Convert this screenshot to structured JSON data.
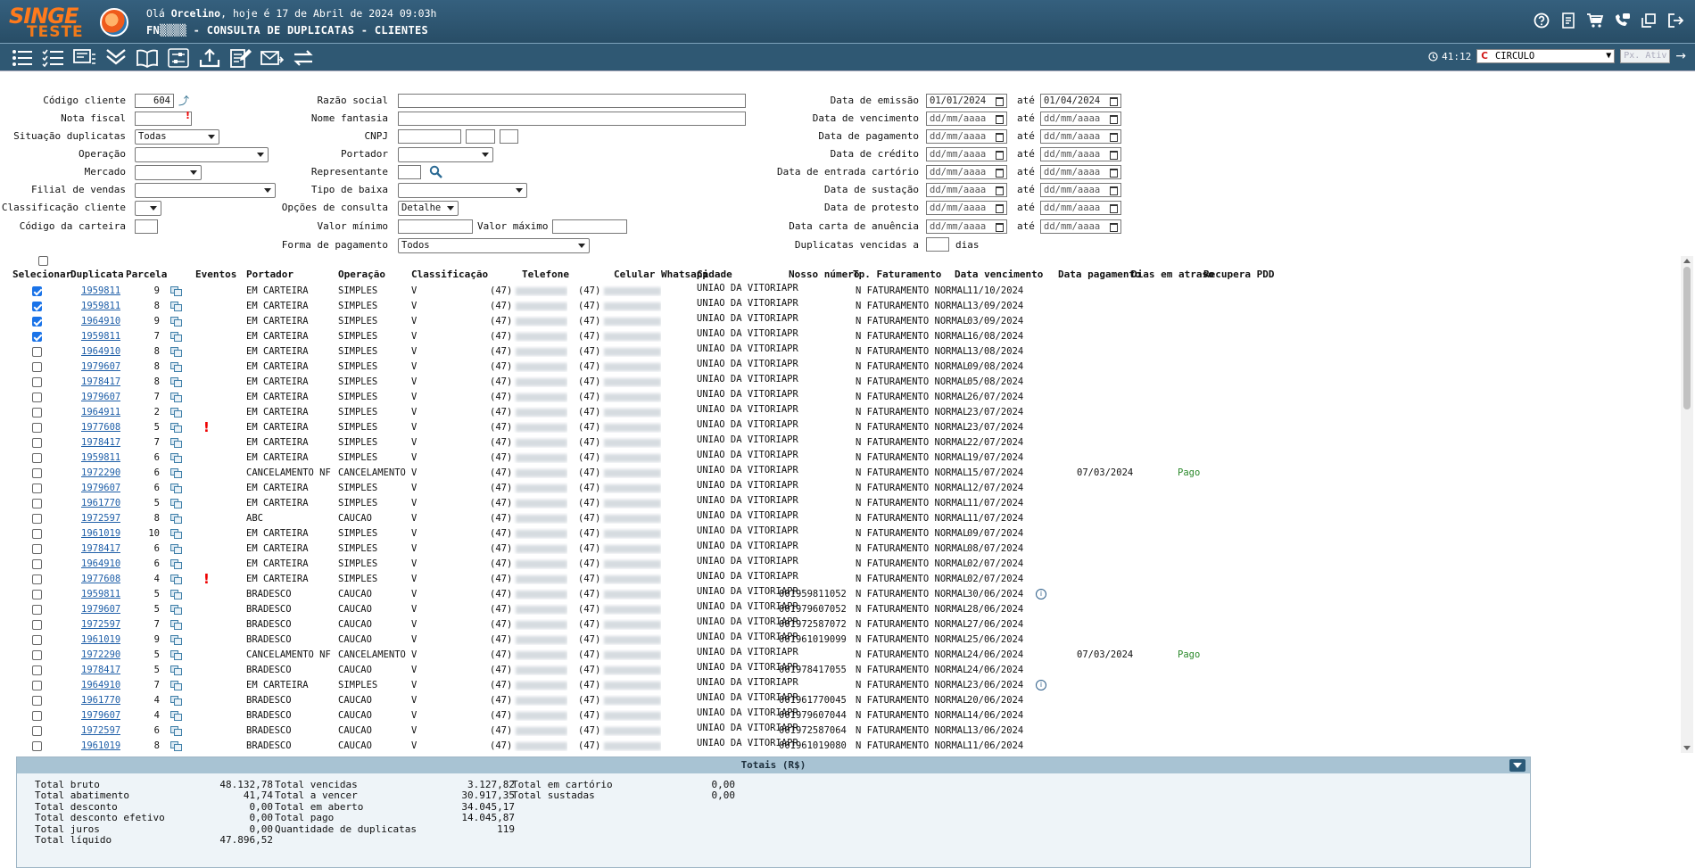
{
  "header": {
    "logo_text": "SINGE",
    "logo_subtext": "TESTE",
    "greeting_prefix": "Olá ",
    "user_name": "Orcelino",
    "greeting_suffix": ", hoje é 17 de Abril de 2024 09:03h",
    "page_title": "FN▒▒▒▒ - CONSULTA DE DUPLICATAS - CLIENTES",
    "icons": [
      "help-icon",
      "report-icon",
      "cart-icon",
      "phone-chat-icon",
      "window-icon",
      "exit-icon"
    ]
  },
  "toolbar": {
    "icons": [
      "list-icon",
      "list-check-icon",
      "card-list-icon",
      "expand-all-icon",
      "book-icon",
      "sliders-icon",
      "upload-icon",
      "edit-doc-icon",
      "send-mail-icon",
      "swap-icon"
    ],
    "timer": "41:12",
    "company": "CIRCULO",
    "company_badge": "C",
    "px_ativ_placeholder": "Px. Ativ"
  },
  "filters": {
    "codigo_cliente_label": "Código cliente",
    "codigo_cliente_value": "604",
    "nota_fiscal_label": "Nota fiscal",
    "situacao_label": "Situação duplicatas",
    "situacao_value": "Todas",
    "operacao_label": "Operação",
    "mercado_label": "Mercado",
    "filial_label": "Filial de vendas",
    "classificacao_label": "Classificação cliente",
    "codigo_carteira_label": "Código da carteira",
    "razao_label": "Razão social",
    "fantasia_label": "Nome fantasia",
    "cnpj_label": "CNPJ",
    "portador_label": "Portador",
    "representante_label": "Representante",
    "tipo_baixa_label": "Tipo de baixa",
    "opcoes_label": "Opções de consulta",
    "opcoes_value": "Detalhe",
    "valor_minimo_label": "Valor mínimo",
    "valor_maximo_label": "Valor máximo",
    "forma_pagamento_label": "Forma de pagamento",
    "forma_pagamento_value": "Todos",
    "ate": "até",
    "date_placeholder": "dd/mm/aaaa",
    "emissao_label": "Data de emissão",
    "emissao_from": "01/01/2024",
    "emissao_to": "01/04/2024",
    "vencimento_label": "Data de vencimento",
    "pagamento_label": "Data de pagamento",
    "credito_label": "Data de crédito",
    "cartorio_label": "Data de entrada cartório",
    "sustacao_label": "Data de sustação",
    "protesto_label": "Data de protesto",
    "anuencia_label": "Data carta de anuência",
    "vencidas_label": "Duplicatas vencidas a",
    "dias": "dias"
  },
  "grid": {
    "columns": [
      "Selecionar",
      "Duplicata",
      "Parcela",
      "Eventos",
      "Portador",
      "Operação",
      "Classificação",
      "Telefone",
      "Celular Whatsapp",
      "Cidade",
      "Nosso número",
      "Tp. Faturamento",
      "Data vencimento",
      "Data pagamento",
      "Dias em atraso",
      "Recupera PDD"
    ],
    "ddd": "(47)",
    "rows": [
      {
        "sel": true,
        "dup": "1959811",
        "parc": "9",
        "alert": false,
        "portador": "EM CARTEIRA",
        "operacao": "SIMPLES",
        "classif": "V",
        "cidade": "UNIAO DA VITORIAPR",
        "nosso": "",
        "tp": "N FATURAMENTO NORMAL",
        "venc": "11/10/2024",
        "info": false,
        "pag": "",
        "atraso": ""
      },
      {
        "sel": true,
        "dup": "1959811",
        "parc": "8",
        "alert": false,
        "portador": "EM CARTEIRA",
        "operacao": "SIMPLES",
        "classif": "V",
        "cidade": "UNIAO DA VITORIAPR",
        "nosso": "",
        "tp": "N FATURAMENTO NORMAL",
        "venc": "13/09/2024",
        "info": false,
        "pag": "",
        "atraso": ""
      },
      {
        "sel": true,
        "dup": "1964910",
        "parc": "9",
        "alert": false,
        "portador": "EM CARTEIRA",
        "operacao": "SIMPLES",
        "classif": "V",
        "cidade": "UNIAO DA VITORIAPR",
        "nosso": "",
        "tp": "N FATURAMENTO NORMAL",
        "venc": "03/09/2024",
        "info": false,
        "pag": "",
        "atraso": ""
      },
      {
        "sel": true,
        "dup": "1959811",
        "parc": "7",
        "alert": false,
        "portador": "EM CARTEIRA",
        "operacao": "SIMPLES",
        "classif": "V",
        "cidade": "UNIAO DA VITORIAPR",
        "nosso": "",
        "tp": "N FATURAMENTO NORMAL",
        "venc": "16/08/2024",
        "info": false,
        "pag": "",
        "atraso": ""
      },
      {
        "sel": false,
        "dup": "1964910",
        "parc": "8",
        "alert": false,
        "portador": "EM CARTEIRA",
        "operacao": "SIMPLES",
        "classif": "V",
        "cidade": "UNIAO DA VITORIAPR",
        "nosso": "",
        "tp": "N FATURAMENTO NORMAL",
        "venc": "13/08/2024",
        "info": false,
        "pag": "",
        "atraso": ""
      },
      {
        "sel": false,
        "dup": "1979607",
        "parc": "8",
        "alert": false,
        "portador": "EM CARTEIRA",
        "operacao": "SIMPLES",
        "classif": "V",
        "cidade": "UNIAO DA VITORIAPR",
        "nosso": "",
        "tp": "N FATURAMENTO NORMAL",
        "venc": "09/08/2024",
        "info": false,
        "pag": "",
        "atraso": ""
      },
      {
        "sel": false,
        "dup": "1978417",
        "parc": "8",
        "alert": false,
        "portador": "EM CARTEIRA",
        "operacao": "SIMPLES",
        "classif": "V",
        "cidade": "UNIAO DA VITORIAPR",
        "nosso": "",
        "tp": "N FATURAMENTO NORMAL",
        "venc": "05/08/2024",
        "info": false,
        "pag": "",
        "atraso": ""
      },
      {
        "sel": false,
        "dup": "1979607",
        "parc": "7",
        "alert": false,
        "portador": "EM CARTEIRA",
        "operacao": "SIMPLES",
        "classif": "V",
        "cidade": "UNIAO DA VITORIAPR",
        "nosso": "",
        "tp": "N FATURAMENTO NORMAL",
        "venc": "26/07/2024",
        "info": false,
        "pag": "",
        "atraso": ""
      },
      {
        "sel": false,
        "dup": "1964911",
        "parc": "2",
        "alert": false,
        "portador": "EM CARTEIRA",
        "operacao": "SIMPLES",
        "classif": "V",
        "cidade": "UNIAO DA VITORIAPR",
        "nosso": "",
        "tp": "N FATURAMENTO NORMAL",
        "venc": "23/07/2024",
        "info": false,
        "pag": "",
        "atraso": ""
      },
      {
        "sel": false,
        "dup": "1977608",
        "parc": "5",
        "alert": true,
        "portador": "EM CARTEIRA",
        "operacao": "SIMPLES",
        "classif": "V",
        "cidade": "UNIAO DA VITORIAPR",
        "nosso": "",
        "tp": "N FATURAMENTO NORMAL",
        "venc": "23/07/2024",
        "info": false,
        "pag": "",
        "atraso": ""
      },
      {
        "sel": false,
        "dup": "1978417",
        "parc": "7",
        "alert": false,
        "portador": "EM CARTEIRA",
        "operacao": "SIMPLES",
        "classif": "V",
        "cidade": "UNIAO DA VITORIAPR",
        "nosso": "",
        "tp": "N FATURAMENTO NORMAL",
        "venc": "22/07/2024",
        "info": false,
        "pag": "",
        "atraso": ""
      },
      {
        "sel": false,
        "dup": "1959811",
        "parc": "6",
        "alert": false,
        "portador": "EM CARTEIRA",
        "operacao": "SIMPLES",
        "classif": "V",
        "cidade": "UNIAO DA VITORIAPR",
        "nosso": "",
        "tp": "N FATURAMENTO NORMAL",
        "venc": "19/07/2024",
        "info": false,
        "pag": "",
        "atraso": ""
      },
      {
        "sel": false,
        "dup": "1972290",
        "parc": "6",
        "alert": false,
        "portador": "CANCELAMENTO NF",
        "operacao": "CANCELAMENTO",
        "classif": "V",
        "cidade": "UNIAO DA VITORIAPR",
        "nosso": "",
        "tp": "N FATURAMENTO NORMAL",
        "venc": "15/07/2024",
        "info": false,
        "pag": "07/03/2024",
        "atraso": "Pago"
      },
      {
        "sel": false,
        "dup": "1979607",
        "parc": "6",
        "alert": false,
        "portador": "EM CARTEIRA",
        "operacao": "SIMPLES",
        "classif": "V",
        "cidade": "UNIAO DA VITORIAPR",
        "nosso": "",
        "tp": "N FATURAMENTO NORMAL",
        "venc": "12/07/2024",
        "info": false,
        "pag": "",
        "atraso": ""
      },
      {
        "sel": false,
        "dup": "1961770",
        "parc": "5",
        "alert": false,
        "portador": "EM CARTEIRA",
        "operacao": "SIMPLES",
        "classif": "V",
        "cidade": "UNIAO DA VITORIAPR",
        "nosso": "",
        "tp": "N FATURAMENTO NORMAL",
        "venc": "11/07/2024",
        "info": false,
        "pag": "",
        "atraso": ""
      },
      {
        "sel": false,
        "dup": "1972597",
        "parc": "8",
        "alert": false,
        "portador": "ABC",
        "operacao": "CAUCAO",
        "classif": "V",
        "cidade": "UNIAO DA VITORIAPR",
        "nosso": "",
        "tp": "N FATURAMENTO NORMAL",
        "venc": "11/07/2024",
        "info": false,
        "pag": "",
        "atraso": ""
      },
      {
        "sel": false,
        "dup": "1961019",
        "parc": "10",
        "alert": false,
        "portador": "EM CARTEIRA",
        "operacao": "SIMPLES",
        "classif": "V",
        "cidade": "UNIAO DA VITORIAPR",
        "nosso": "",
        "tp": "N FATURAMENTO NORMAL",
        "venc": "09/07/2024",
        "info": false,
        "pag": "",
        "atraso": ""
      },
      {
        "sel": false,
        "dup": "1978417",
        "parc": "6",
        "alert": false,
        "portador": "EM CARTEIRA",
        "operacao": "SIMPLES",
        "classif": "V",
        "cidade": "UNIAO DA VITORIAPR",
        "nosso": "",
        "tp": "N FATURAMENTO NORMAL",
        "venc": "08/07/2024",
        "info": false,
        "pag": "",
        "atraso": ""
      },
      {
        "sel": false,
        "dup": "1964910",
        "parc": "6",
        "alert": false,
        "portador": "EM CARTEIRA",
        "operacao": "SIMPLES",
        "classif": "V",
        "cidade": "UNIAO DA VITORIAPR",
        "nosso": "",
        "tp": "N FATURAMENTO NORMAL",
        "venc": "02/07/2024",
        "info": false,
        "pag": "",
        "atraso": ""
      },
      {
        "sel": false,
        "dup": "1977608",
        "parc": "4",
        "alert": true,
        "portador": "EM CARTEIRA",
        "operacao": "SIMPLES",
        "classif": "V",
        "cidade": "UNIAO DA VITORIAPR",
        "nosso": "",
        "tp": "N FATURAMENTO NORMAL",
        "venc": "02/07/2024",
        "info": false,
        "pag": "",
        "atraso": ""
      },
      {
        "sel": false,
        "dup": "1959811",
        "parc": "5",
        "alert": false,
        "portador": "BRADESCO",
        "operacao": "CAUCAO",
        "classif": "V",
        "cidade": "UNIAO DA VITORIAPR",
        "nosso": "001959811052",
        "tp": "N FATURAMENTO NORMAL",
        "venc": "30/06/2024",
        "info": true,
        "pag": "",
        "atraso": ""
      },
      {
        "sel": false,
        "dup": "1979607",
        "parc": "5",
        "alert": false,
        "portador": "BRADESCO",
        "operacao": "CAUCAO",
        "classif": "V",
        "cidade": "UNIAO DA VITORIAPR",
        "nosso": "001979607052",
        "tp": "N FATURAMENTO NORMAL",
        "venc": "28/06/2024",
        "info": false,
        "pag": "",
        "atraso": ""
      },
      {
        "sel": false,
        "dup": "1972597",
        "parc": "7",
        "alert": false,
        "portador": "BRADESCO",
        "operacao": "CAUCAO",
        "classif": "V",
        "cidade": "UNIAO DA VITORIAPR",
        "nosso": "001972587072",
        "tp": "N FATURAMENTO NORMAL",
        "venc": "27/06/2024",
        "info": false,
        "pag": "",
        "atraso": ""
      },
      {
        "sel": false,
        "dup": "1961019",
        "parc": "9",
        "alert": false,
        "portador": "BRADESCO",
        "operacao": "CAUCAO",
        "classif": "V",
        "cidade": "UNIAO DA VITORIAPR",
        "nosso": "001961019099",
        "tp": "N FATURAMENTO NORMAL",
        "venc": "25/06/2024",
        "info": false,
        "pag": "",
        "atraso": ""
      },
      {
        "sel": false,
        "dup": "1972290",
        "parc": "5",
        "alert": false,
        "portador": "CANCELAMENTO NF",
        "operacao": "CANCELAMENTO",
        "classif": "V",
        "cidade": "UNIAO DA VITORIAPR",
        "nosso": "",
        "tp": "N FATURAMENTO NORMAL",
        "venc": "24/06/2024",
        "info": false,
        "pag": "07/03/2024",
        "atraso": "Pago"
      },
      {
        "sel": false,
        "dup": "1978417",
        "parc": "5",
        "alert": false,
        "portador": "BRADESCO",
        "operacao": "CAUCAO",
        "classif": "V",
        "cidade": "UNIAO DA VITORIAPR",
        "nosso": "001978417055",
        "tp": "N FATURAMENTO NORMAL",
        "venc": "24/06/2024",
        "info": false,
        "pag": "",
        "atraso": ""
      },
      {
        "sel": false,
        "dup": "1964910",
        "parc": "7",
        "alert": false,
        "portador": "EM CARTEIRA",
        "operacao": "SIMPLES",
        "classif": "V",
        "cidade": "UNIAO DA VITORIAPR",
        "nosso": "",
        "tp": "N FATURAMENTO NORMAL",
        "venc": "23/06/2024",
        "info": true,
        "pag": "",
        "atraso": ""
      },
      {
        "sel": false,
        "dup": "1961770",
        "parc": "4",
        "alert": false,
        "portador": "BRADESCO",
        "operacao": "CAUCAO",
        "classif": "V",
        "cidade": "UNIAO DA VITORIAPR",
        "nosso": "001961770045",
        "tp": "N FATURAMENTO NORMAL",
        "venc": "20/06/2024",
        "info": false,
        "pag": "",
        "atraso": ""
      },
      {
        "sel": false,
        "dup": "1979607",
        "parc": "4",
        "alert": false,
        "portador": "BRADESCO",
        "operacao": "CAUCAO",
        "classif": "V",
        "cidade": "UNIAO DA VITORIAPR",
        "nosso": "001979607044",
        "tp": "N FATURAMENTO NORMAL",
        "venc": "14/06/2024",
        "info": false,
        "pag": "",
        "atraso": ""
      },
      {
        "sel": false,
        "dup": "1972597",
        "parc": "6",
        "alert": false,
        "portador": "BRADESCO",
        "operacao": "CAUCAO",
        "classif": "V",
        "cidade": "UNIAO DA VITORIAPR",
        "nosso": "001972587064",
        "tp": "N FATURAMENTO NORMAL",
        "venc": "13/06/2024",
        "info": false,
        "pag": "",
        "atraso": ""
      },
      {
        "sel": false,
        "dup": "1961019",
        "parc": "8",
        "alert": false,
        "portador": "BRADESCO",
        "operacao": "CAUCAO",
        "classif": "V",
        "cidade": "UNIAO DA VITORIAPR",
        "nosso": "001961019080",
        "tp": "N FATURAMENTO NORMAL",
        "venc": "11/06/2024",
        "info": false,
        "pag": "",
        "atraso": ""
      }
    ]
  },
  "totals": {
    "title": "Totais (R$)",
    "col1": [
      {
        "label": "Total bruto",
        "value": "48.132,78"
      },
      {
        "label": "Total abatimento",
        "value": "41,74"
      },
      {
        "label": "Total desconto",
        "value": "0,00"
      },
      {
        "label": "Total desconto efetivo",
        "value": "0,00"
      },
      {
        "label": "Total juros",
        "value": "0,00"
      },
      {
        "label": "Total líquido",
        "value": "47.896,52"
      }
    ],
    "col2": [
      {
        "label": "Total vencidas",
        "value": "3.127,82"
      },
      {
        "label": "Total a vencer",
        "value": "30.917,35"
      },
      {
        "label": "Total em aberto",
        "value": "34.045,17"
      },
      {
        "label": "Total pago",
        "value": "14.045,87"
      },
      {
        "label": "Quantidade de duplicatas",
        "value": "119"
      }
    ],
    "col3": [
      {
        "label": "Total em cartório",
        "value": "0,00"
      },
      {
        "label": "Total sustadas",
        "value": "0,00"
      }
    ]
  }
}
